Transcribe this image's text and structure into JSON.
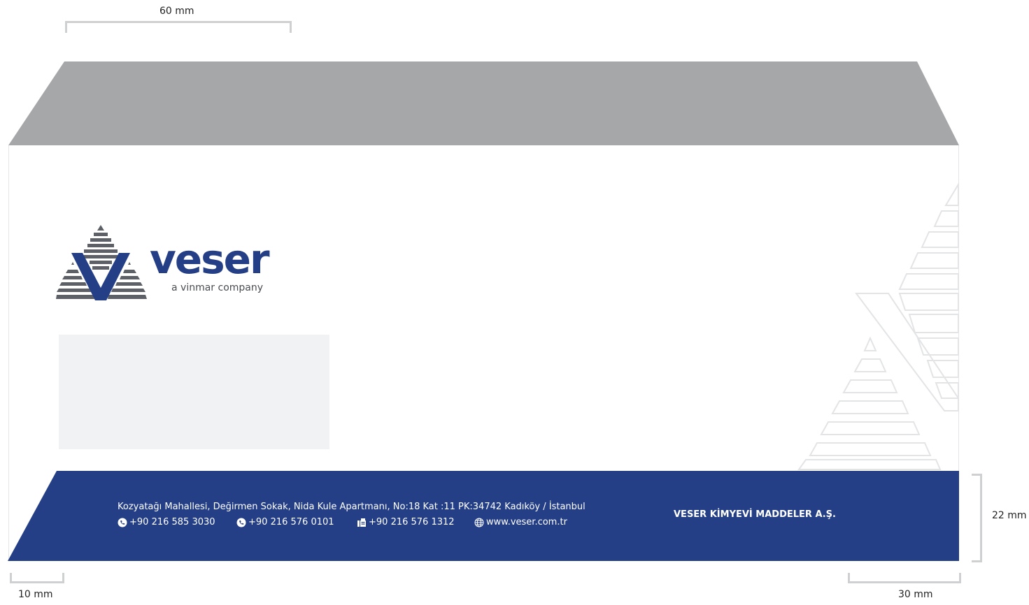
{
  "dimensions": {
    "top_width": "60 mm",
    "left_margin": "10 mm",
    "right_margin": "30 mm",
    "footer_height": "22 mm"
  },
  "logo": {
    "name": "veser",
    "tagline": "a vinmar company"
  },
  "footer": {
    "address": "Kozyatağı Mahallesi, Değirmen Sokak, Nida Kule Apartmanı, No:18 Kat :11 PK:34742 Kadıköy / İstanbul",
    "contacts": [
      {
        "icon": "phone-icon",
        "text": "+90 216 585 3030"
      },
      {
        "icon": "phone-icon",
        "text": "+90 216 576 0101"
      },
      {
        "icon": "fax-icon",
        "text": "+90 216 576 1312"
      },
      {
        "icon": "globe-icon",
        "text": "www.veser.com.tr"
      }
    ],
    "company": "VESER KİMYEVİ MADDELER A.Ş."
  },
  "colors": {
    "flap": "#a6a7a9",
    "brand_blue": "#243f86",
    "logo_gray": "#5d6167",
    "window": "#f1f2f4",
    "watermark": "#e3e4e6"
  }
}
